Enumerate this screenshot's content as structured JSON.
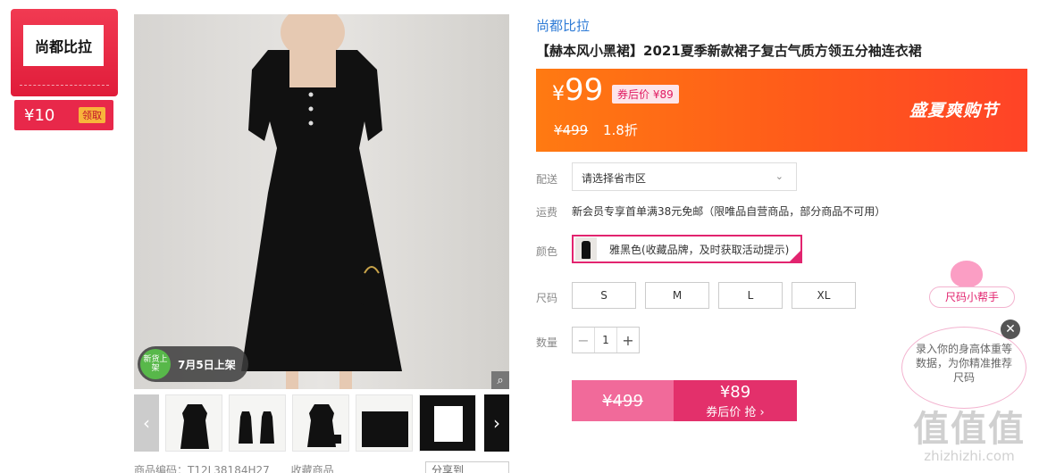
{
  "brand_card": {
    "logo_text": "尚都比拉",
    "coupon_value": "¥10",
    "coupon_claim": "领取"
  },
  "gallery": {
    "badge_circle": "新货上架",
    "badge_text": "7月5日上架",
    "prev_arrow": "‹",
    "next_arrow": "›",
    "zoom_icon": "⌕"
  },
  "bottom_row": {
    "product_code": "商品编码：T12L38184H27",
    "favorite": "收藏商品",
    "share": "分享到"
  },
  "product": {
    "brand_link": "尚都比拉",
    "title": "【赫本风小黑裙】2021夏季新款裙子复古气质方领五分袖连衣裙"
  },
  "price": {
    "currency": "¥",
    "current": "99",
    "after_coupon": "券后价 ¥89",
    "original": "¥499",
    "discount": "1.8折",
    "event": "盛夏爽购节"
  },
  "delivery": {
    "label": "配送",
    "placeholder": "请选择省市区",
    "chevron": "⌄"
  },
  "shipping": {
    "label": "运费",
    "text": "新会员专享首单满38元免邮（限唯品自营商品，部分商品不可用）"
  },
  "color": {
    "label": "颜色",
    "option": "雅黑色(收藏品牌，及时获取活动提示)"
  },
  "size": {
    "label": "尺码",
    "options": [
      "S",
      "M",
      "L",
      "XL"
    ]
  },
  "quantity": {
    "label": "数量",
    "minus": "−",
    "value": "1",
    "plus": "+"
  },
  "buy": {
    "original_price": "¥499",
    "coupon_price": "¥89",
    "coupon_action": "券后价 抢 ›"
  },
  "size_helper": {
    "title": "尺码小帮手",
    "bubble": "录入你的身高体重等数据，为你精准推荐尺码",
    "close": "✕"
  },
  "watermark": {
    "big": "值值值",
    "small": "zhizhizhi.com"
  },
  "colors": {
    "accent": "#e2246f",
    "banner": "#ff5a1a",
    "link": "#2e7bd6"
  }
}
